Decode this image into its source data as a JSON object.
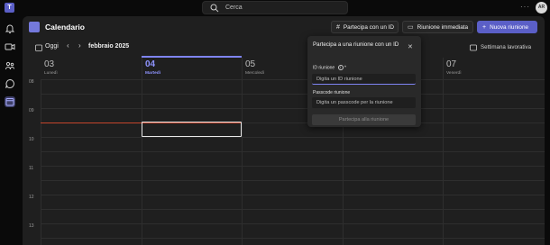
{
  "topbar": {
    "app_logo": "T",
    "search_placeholder": "Cerca",
    "more": "···",
    "avatar_initials": "AR"
  },
  "rail": {
    "icons": [
      "bell-icon",
      "video-icon",
      "teams-icon",
      "chat-icon",
      "calendar-icon"
    ]
  },
  "header": {
    "title": "Calendario",
    "join_id_label": "Partecipa con un ID",
    "meet_now_label": "Riunione immediata",
    "new_meeting_label": "Nuova riunione"
  },
  "toolbar": {
    "today_label": "Oggi",
    "month_label": "febbraio 2025",
    "view_label": "Settimana lavorativa"
  },
  "days": [
    {
      "num": "03",
      "name": "Lunedì"
    },
    {
      "num": "04",
      "name": "Martedì"
    },
    {
      "num": "05",
      "name": "Mercoledì"
    },
    {
      "num": "",
      "name": ""
    },
    {
      "num": "07",
      "name": "Venerdì"
    }
  ],
  "hours": [
    "08",
    "09",
    "10",
    "11",
    "12",
    "13"
  ],
  "popup": {
    "title": "Partecipa a una riunione con un ID",
    "id_label": "ID riunione",
    "required_mark": "*",
    "id_placeholder": "Digita un ID riunione",
    "passcode_label": "Passcode riunione",
    "passcode_placeholder": "Digita un passcode per la riunione",
    "join_button": "Partecipa alla riunione"
  },
  "colors": {
    "accent": "#5b5fc7",
    "today": "#8f94ff",
    "now_line": "#c4452b"
  }
}
